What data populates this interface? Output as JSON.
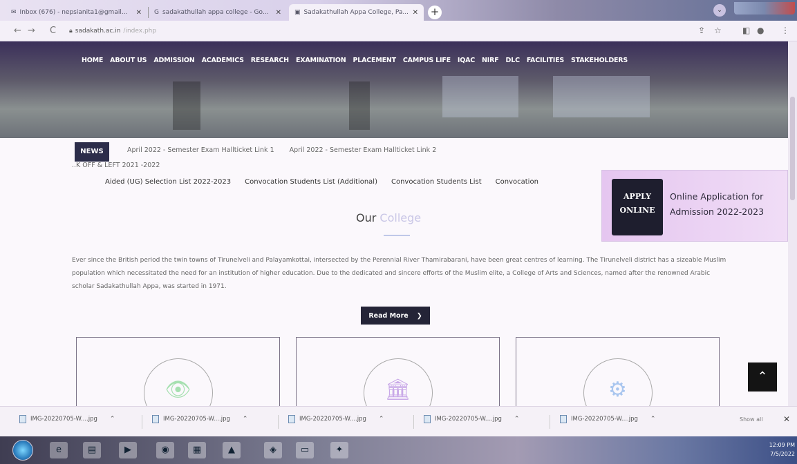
{
  "browser": {
    "tabs": [
      {
        "title": "Inbox (676) - nepsianita1@gmail...",
        "favicon": "mail-icon"
      },
      {
        "title": "sadakathullah appa college - Go...",
        "favicon": "google-icon"
      },
      {
        "title": "Sadakathullah Appa College, Pa...",
        "favicon": "site-icon",
        "active": true
      }
    ],
    "new_tab": "+",
    "url_host": "sadakath.ac.in",
    "url_path": "/index.php"
  },
  "site": {
    "nav": [
      "HOME",
      "ABOUT US",
      "ADMISSION",
      "ACADEMICS",
      "RESEARCH",
      "EXAMINATION",
      "PLACEMENT",
      "CAMPUS LIFE",
      "IQAC",
      "NIRF",
      "DLC",
      "FACILITIES",
      "STAKEHOLDERS"
    ],
    "news_label": "NEWS",
    "news_items": [
      "April 2022 - Semester Exam Hallticket Link 1",
      "April 2022 - Semester Exam Hallticket Link 2"
    ],
    "news_sub": "..K OFF & LEFT 2021 -2022",
    "quick_links": [
      "Aided (UG) Selection List 2022-2023",
      "Convocation Students List (Additional)",
      "Convocation Students List",
      "Convocation"
    ],
    "apply": {
      "badge_line1": "APPLY",
      "badge_line2": "ONLINE",
      "text": "Online Application for Admission 2022-2023"
    },
    "section_title_a": "Our",
    "section_title_b": "College",
    "about_text": "Ever since the British period the twin towns of Tirunelveli and Palayamkottai, intersected by the Perennial River Thamirabarani, have been great centres of learning. The Tirunelveli district has a sizeable Muslim population which necessitated the need for an institution of higher education. Due to the dedicated and sincere efforts of the Muslim elite, a College of Arts and Sciences, named after the renowned Arabic scholar Sadakathullah Appa, was started in 1971.",
    "read_more": "Read More",
    "cards": [
      {
        "icon": "eye-icon",
        "color": "#a6e0b0"
      },
      {
        "icon": "institution-icon",
        "color": "#c9a9e8"
      },
      {
        "icon": "gear-icon",
        "color": "#a9c6ef"
      }
    ]
  },
  "downloads": {
    "items": [
      "IMG-20220705-W....jpg",
      "IMG-20220705-W....jpg",
      "IMG-20220705-W....jpg",
      "IMG-20220705-W....jpg",
      "IMG-20220705-W....jpg"
    ],
    "show_all": "Show all"
  },
  "taskbar": {
    "time": "12:09 PM",
    "date": "7/5/2022"
  }
}
